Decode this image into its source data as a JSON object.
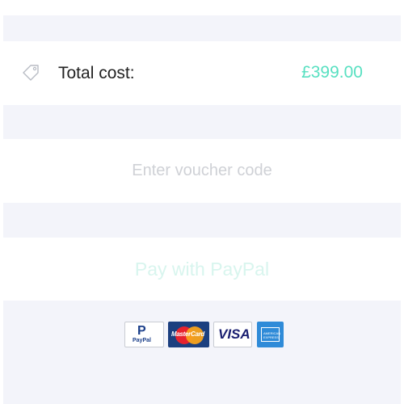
{
  "checkout": {
    "total_label": "Total cost:",
    "total_value": "£399.00",
    "voucher_placeholder": "Enter voucher code",
    "paypal_button_label": "Pay with PayPal",
    "payment_logos": {
      "paypal_text": "PayPal",
      "paypal_mark": "P",
      "mastercard_text": "MasterCard",
      "visa_text": "VISA",
      "amex_text": "AMERICAN EXPRESS"
    }
  },
  "icons": {
    "tag": "tag-icon"
  },
  "colors": {
    "accent": "#58e0c1",
    "band_background": "#f3f4fa",
    "label_text": "#222222",
    "placeholder_text": "#cfd1d6",
    "paypal_button_text": "#d8f5ee"
  }
}
